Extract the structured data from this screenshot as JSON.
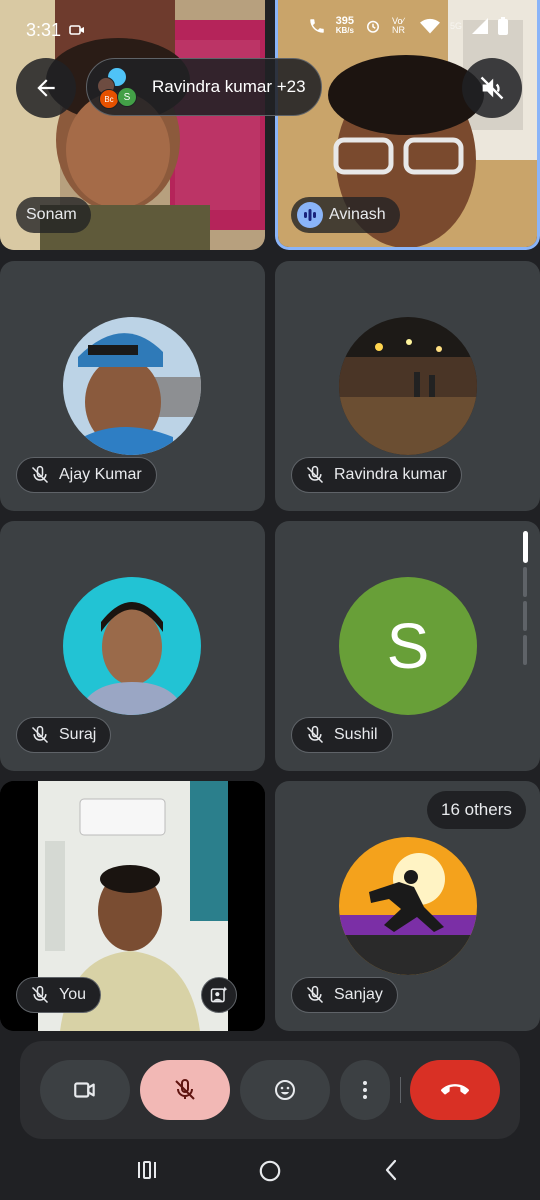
{
  "status_bar": {
    "time": "3:31",
    "speed": "395",
    "speed_unit": "KB/s",
    "network": "Vo∕ NR",
    "signal": "5G"
  },
  "header": {
    "participants_label": "Ravindra kumar +23",
    "mini_avatars": [
      "Bc",
      "S"
    ]
  },
  "tiles": [
    {
      "name": "Sonam"
    },
    {
      "name": "Avinash"
    },
    {
      "name": "Ajay Kumar"
    },
    {
      "name": "Ravindra kumar"
    },
    {
      "name": "Suraj"
    },
    {
      "name": "Sushil",
      "initial": "S",
      "avatar_color": "#689f38"
    },
    {
      "name": "You"
    },
    {
      "name": "Sanjay",
      "others_label": "16 others"
    }
  ],
  "colors": {
    "speaking_border": "#8ab4f8",
    "end_call": "#d93025",
    "mic_off_bg": "#f2b8b5",
    "pill_bg": "#202124"
  }
}
